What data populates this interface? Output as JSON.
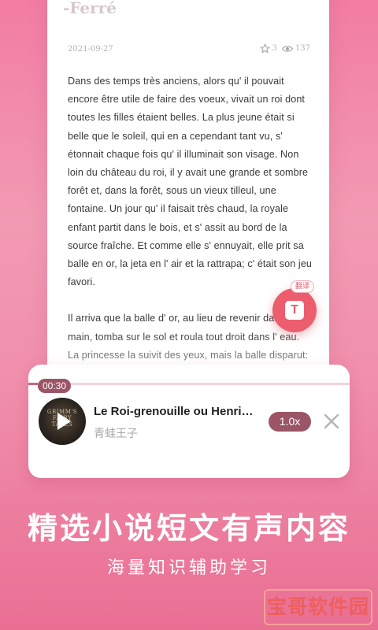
{
  "article": {
    "title": "-Ferré",
    "date": "2021-09-27",
    "likes": "3",
    "views": "137",
    "paragraphs": [
      "Dans des temps très anciens, alors qu' il pouvait encore être utile de faire des voeux, vivait un roi dont toutes les filles étaient belles. La plus jeune était si belle que le soleil, qui en a cependant tant vu, s' étonnait chaque fois qu' il illuminait son visage. Non loin du château du roi, il y avait une grande et sombre forêt et, dans la forêt, sous un vieux tilleul, une fontaine. Un jour qu' il faisait très chaud, la royale enfant partit dans le bois, et s' assit au bord de la source fraîche. Et comme elle s' ennuyait, elle prit sa balle en or, la jeta en l' air et la rattrapa; c' était son jeu favori.",
      "Il arriva que la balle d' or, au lieu de revenir dans sa main, tomba sur le sol et roula tout droit dans l' eau. La princesse la suivit des yeux, mais la balle disparut:"
    ]
  },
  "translate": {
    "badge": "翻译",
    "letter": "T",
    "icon": "translate-icon"
  },
  "player": {
    "time": "00:30",
    "progress": 0.03,
    "title": "Le Roi-grenouille ou Henri…",
    "subtitle": "青蛙王子",
    "speed": "1.0x",
    "cover_text": "GRIMM'S FAIRY TALES",
    "icons": {
      "play": "play-icon",
      "close": "close-icon"
    }
  },
  "promo": {
    "headline": "精选小说短文有声内容",
    "subline": "海量知识辅助学习"
  },
  "watermark": "宝哥软件园",
  "colors": {
    "accent": "#9b5567",
    "fab": "#ec5d6d",
    "background_top": "#f27da2",
    "background_bottom": "#e96f93"
  }
}
